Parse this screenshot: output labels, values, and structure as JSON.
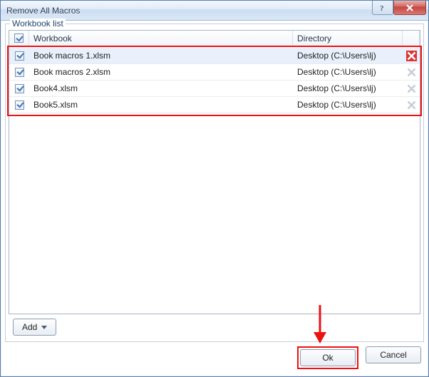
{
  "window": {
    "title": "Remove All Macros"
  },
  "group": {
    "legend": "Workbook list"
  },
  "columns": {
    "workbook": "Workbook",
    "directory": "Directory"
  },
  "rows": [
    {
      "checked": true,
      "name": "Book macros 1.xlsm",
      "dir": "Desktop (C:\\Users\\lj)",
      "selected": true,
      "x_active": true
    },
    {
      "checked": true,
      "name": "Book macros 2.xlsm",
      "dir": "Desktop (C:\\Users\\lj)",
      "selected": false,
      "x_active": false
    },
    {
      "checked": true,
      "name": "Book4.xlsm",
      "dir": "Desktop (C:\\Users\\lj)",
      "selected": false,
      "x_active": false
    },
    {
      "checked": true,
      "name": "Book5.xlsm",
      "dir": "Desktop (C:\\Users\\lj)",
      "selected": false,
      "x_active": false
    }
  ],
  "buttons": {
    "add": "Add",
    "ok": "Ok",
    "cancel": "Cancel"
  }
}
